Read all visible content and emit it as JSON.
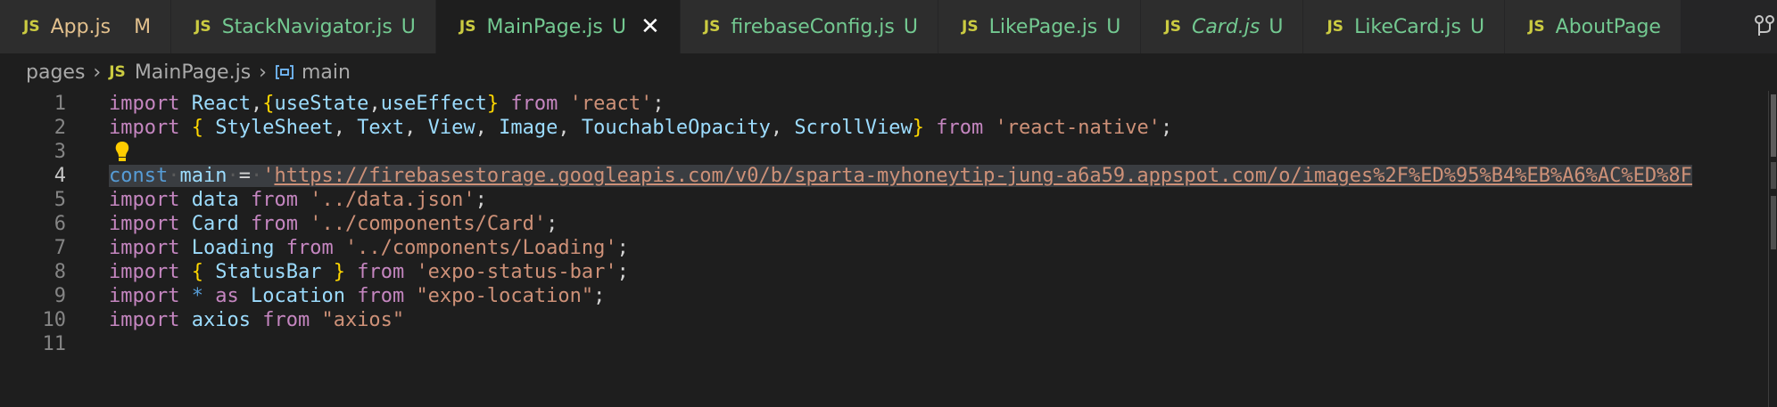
{
  "tabs": [
    {
      "label": "App.js",
      "status": "M",
      "italic": false,
      "modified": true,
      "active": false
    },
    {
      "label": "StackNavigator.js",
      "status": "U",
      "italic": false,
      "modified": false,
      "active": false
    },
    {
      "label": "MainPage.js",
      "status": "U",
      "italic": false,
      "modified": false,
      "active": true
    },
    {
      "label": "firebaseConfig.js",
      "status": "U",
      "italic": false,
      "modified": false,
      "active": false
    },
    {
      "label": "LikePage.js",
      "status": "U",
      "italic": false,
      "modified": false,
      "active": false
    },
    {
      "label": "Card.js",
      "status": "U",
      "italic": true,
      "modified": false,
      "active": false
    },
    {
      "label": "LikeCard.js",
      "status": "U",
      "italic": false,
      "modified": false,
      "active": false
    },
    {
      "label": "AboutPage",
      "status": "",
      "italic": false,
      "modified": false,
      "active": false
    }
  ],
  "file_badge": "JS",
  "breadcrumb": {
    "folder": "pages",
    "file": "MainPage.js",
    "symbol": "main"
  },
  "editor": {
    "current_line": 4,
    "lines": [
      {
        "n": "1",
        "tokens": [
          [
            "kw",
            "import"
          ],
          [
            "pun",
            " "
          ],
          [
            "var",
            "React"
          ],
          [
            "pun",
            ","
          ],
          [
            "br",
            "{"
          ],
          [
            "var",
            "useState"
          ],
          [
            "pun",
            ","
          ],
          [
            "var",
            "useEffect"
          ],
          [
            "br",
            "}"
          ],
          [
            "pun",
            " "
          ],
          [
            "kw",
            "from"
          ],
          [
            "pun",
            " "
          ],
          [
            "str",
            "'react'"
          ],
          [
            "pun",
            ";"
          ]
        ]
      },
      {
        "n": "2",
        "tokens": [
          [
            "kw",
            "import"
          ],
          [
            "pun",
            " "
          ],
          [
            "br",
            "{"
          ],
          [
            "pun",
            " "
          ],
          [
            "var",
            "StyleSheet"
          ],
          [
            "pun",
            ", "
          ],
          [
            "var",
            "Text"
          ],
          [
            "pun",
            ", "
          ],
          [
            "var",
            "View"
          ],
          [
            "pun",
            ", "
          ],
          [
            "var",
            "Image"
          ],
          [
            "pun",
            ", "
          ],
          [
            "var",
            "TouchableOpacity"
          ],
          [
            "pun",
            ", "
          ],
          [
            "var",
            "ScrollView"
          ],
          [
            "br",
            "}"
          ],
          [
            "pun",
            " "
          ],
          [
            "kw",
            "from"
          ],
          [
            "pun",
            " "
          ],
          [
            "str",
            "'react-native'"
          ],
          [
            "pun",
            ";"
          ]
        ]
      },
      {
        "n": "3",
        "tokens": []
      },
      {
        "n": "4",
        "tokens": [
          [
            "sk hl",
            "const"
          ],
          [
            "ws hl",
            "·"
          ],
          [
            "var hl",
            "main"
          ],
          [
            "ws hl",
            "·"
          ],
          [
            "pun hl",
            "="
          ],
          [
            "ws hl",
            "·"
          ],
          [
            "str hl",
            "'"
          ],
          [
            "str hl url",
            "https://firebasestorage.googleapis.com/v0/b/sparta-myhoneytip-jung-a6a59.appspot.com/o/images%2F%ED%95%B4%EB%A6%AC%ED%8F"
          ]
        ]
      },
      {
        "n": "5",
        "tokens": [
          [
            "kw",
            "import"
          ],
          [
            "pun",
            " "
          ],
          [
            "var",
            "data"
          ],
          [
            "pun",
            " "
          ],
          [
            "kw",
            "from"
          ],
          [
            "pun",
            " "
          ],
          [
            "str",
            "'../data.json'"
          ],
          [
            "pun",
            ";"
          ]
        ]
      },
      {
        "n": "6",
        "tokens": [
          [
            "kw",
            "import"
          ],
          [
            "pun",
            " "
          ],
          [
            "var",
            "Card"
          ],
          [
            "pun",
            " "
          ],
          [
            "kw",
            "from"
          ],
          [
            "pun",
            " "
          ],
          [
            "str",
            "'../components/Card'"
          ],
          [
            "pun",
            ";"
          ]
        ]
      },
      {
        "n": "7",
        "tokens": [
          [
            "kw",
            "import"
          ],
          [
            "pun",
            " "
          ],
          [
            "var",
            "Loading"
          ],
          [
            "pun",
            " "
          ],
          [
            "kw",
            "from"
          ],
          [
            "pun",
            " "
          ],
          [
            "str",
            "'../components/Loading'"
          ],
          [
            "pun",
            ";"
          ]
        ]
      },
      {
        "n": "8",
        "tokens": [
          [
            "kw",
            "import"
          ],
          [
            "pun",
            " "
          ],
          [
            "br",
            "{"
          ],
          [
            "pun",
            " "
          ],
          [
            "var",
            "StatusBar"
          ],
          [
            "pun",
            " "
          ],
          [
            "br",
            "}"
          ],
          [
            "pun",
            " "
          ],
          [
            "kw",
            "from"
          ],
          [
            "pun",
            " "
          ],
          [
            "str",
            "'expo-status-bar'"
          ],
          [
            "pun",
            ";"
          ]
        ]
      },
      {
        "n": "9",
        "tokens": [
          [
            "kw",
            "import"
          ],
          [
            "pun",
            " "
          ],
          [
            "sk",
            "*"
          ],
          [
            "pun",
            " "
          ],
          [
            "kw",
            "as"
          ],
          [
            "pun",
            " "
          ],
          [
            "var",
            "Location"
          ],
          [
            "pun",
            " "
          ],
          [
            "kw",
            "from"
          ],
          [
            "pun",
            " "
          ],
          [
            "str",
            "\"expo-location\""
          ],
          [
            "pun",
            ";"
          ]
        ]
      },
      {
        "n": "10",
        "tokens": [
          [
            "kw",
            "import"
          ],
          [
            "pun",
            " "
          ],
          [
            "var",
            "axios"
          ],
          [
            "pun",
            " "
          ],
          [
            "kw",
            "from"
          ],
          [
            "pun",
            " "
          ],
          [
            "str",
            "\"axios\""
          ]
        ]
      },
      {
        "n": "11",
        "tokens": []
      }
    ]
  },
  "icons": {
    "tab_close": "close-icon",
    "lightbulb": "lightbulb-icon",
    "breadcrumb_symbol": "symbol-variable-icon",
    "breadcrumb_separator": "chevron-right-icon",
    "top_right": "split-editor-icon"
  },
  "colors": {
    "editor_bg": "#1e1e1e",
    "tabbar_bg": "#252526",
    "untracked": "#73c991",
    "modified": "#e2c08d",
    "js_badge": "#cbcb41",
    "keyword": "#c586c0",
    "storage": "#569cd6",
    "variable": "#9cdcfe",
    "string": "#ce9178",
    "bracket": "#ffd700"
  }
}
